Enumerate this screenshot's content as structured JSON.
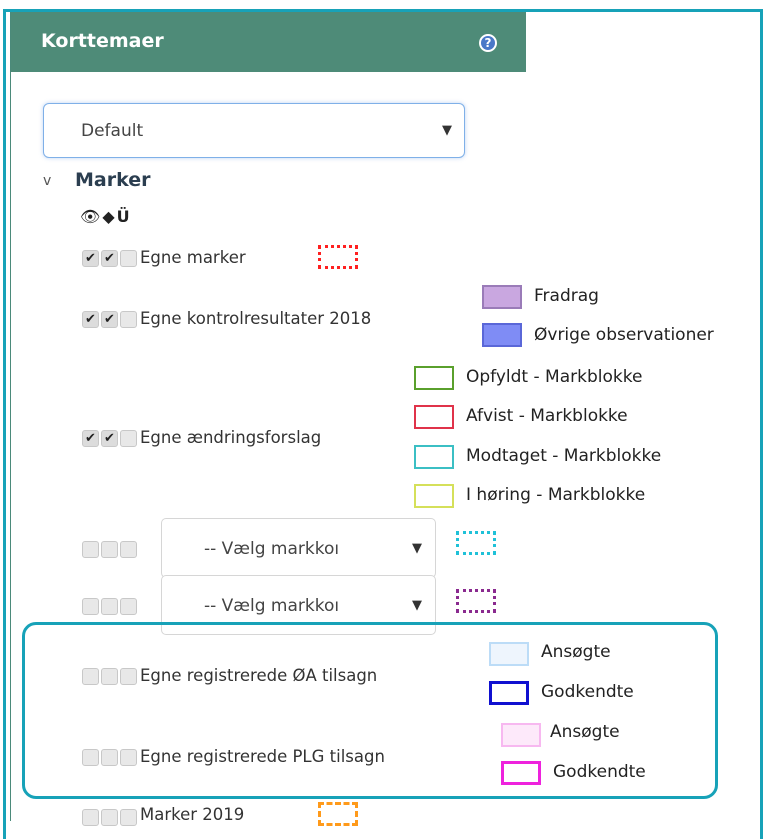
{
  "panel": {
    "title": "Korttemaer",
    "help_icon": "?"
  },
  "theme_select": {
    "value": "Default"
  },
  "section": {
    "toggle": "v",
    "title": "Marker",
    "header_icons": [
      "eye-icon",
      "tag-icon",
      "magnet-icon"
    ]
  },
  "rows": [
    {
      "label": "Egne marker",
      "checks": [
        true,
        true,
        false
      ]
    },
    {
      "label": "Egne kontrolresultater 2018",
      "checks": [
        true,
        true,
        false
      ],
      "legend": [
        "Fradrag",
        "Øvrige observationer"
      ]
    },
    {
      "label": "Egne ændringsforslag",
      "checks": [
        true,
        true,
        false
      ],
      "legend": [
        "Opfyldt - Markblokke",
        "Afvist - Markblokke",
        "Modtaget - Markblokke",
        "I høring - Markblokke"
      ]
    },
    {
      "select_placeholder": "-- Vælg markkoı",
      "checks": [
        false,
        false,
        false
      ]
    },
    {
      "select_placeholder": "-- Vælg markkoı",
      "checks": [
        false,
        false,
        false
      ]
    },
    {
      "label": "Egne registrerede ØA tilsagn",
      "checks": [
        false,
        false,
        false
      ],
      "legend": [
        "Ansøgte",
        "Godkendte"
      ]
    },
    {
      "label": "Egne registrerede PLG tilsagn",
      "checks": [
        false,
        false,
        false
      ],
      "legend": [
        "Ansøgte",
        "Godkendte"
      ]
    },
    {
      "label": "Marker 2019",
      "checks": [
        false,
        false,
        false
      ]
    }
  ],
  "check_glyph": "✔",
  "caret_glyph": "▼",
  "colors": {
    "header_bg": "#4e8b78",
    "frame": "#17a2b8",
    "egne_marker": "#ff2020",
    "fradrag": "#c9a7e0",
    "ovrige": "#7f8cf5",
    "opfyldt": "#5aa02c",
    "afvist": "#e0334a",
    "modtaget": "#3bbfc4",
    "i_horing": "#d5e05a",
    "select1_swatch": "#1fc1d8",
    "select2_swatch": "#8a2a8f",
    "oa_ansogte": "#bcdcf7",
    "oa_godkendte": "#1010d0",
    "plg_ansogte": "#f7b8f0",
    "plg_godkendte": "#ee22dd",
    "marker2019": "#ff9a1a"
  }
}
